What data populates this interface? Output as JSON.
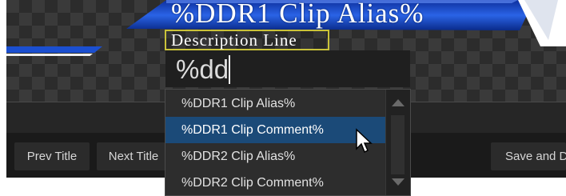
{
  "preview": {
    "title_text": "%DDR1 Clip Alias%",
    "description_text": "Description Line"
  },
  "entry": {
    "value": "%dd"
  },
  "toolbar": {
    "prev_title_label": "Prev Title",
    "next_title_label": "Next Title",
    "save_label": "Save and D"
  },
  "autocomplete": {
    "items": [
      {
        "label": "%DDR1 Clip Alias%"
      },
      {
        "label": "%DDR1 Clip Comment%"
      },
      {
        "label": "%DDR2 Clip Alias%"
      },
      {
        "label": "%DDR2 Clip Comment%"
      }
    ],
    "selected_index": 1
  },
  "icons": {
    "scroll_up": "chevron-up-icon",
    "scroll_down": "chevron-down-icon",
    "cursor": "mouse-pointer-icon"
  },
  "colors": {
    "banner_blue": "#1a4fd0",
    "selection": "#1b4a78",
    "description_box_border": "#c9c23a"
  }
}
